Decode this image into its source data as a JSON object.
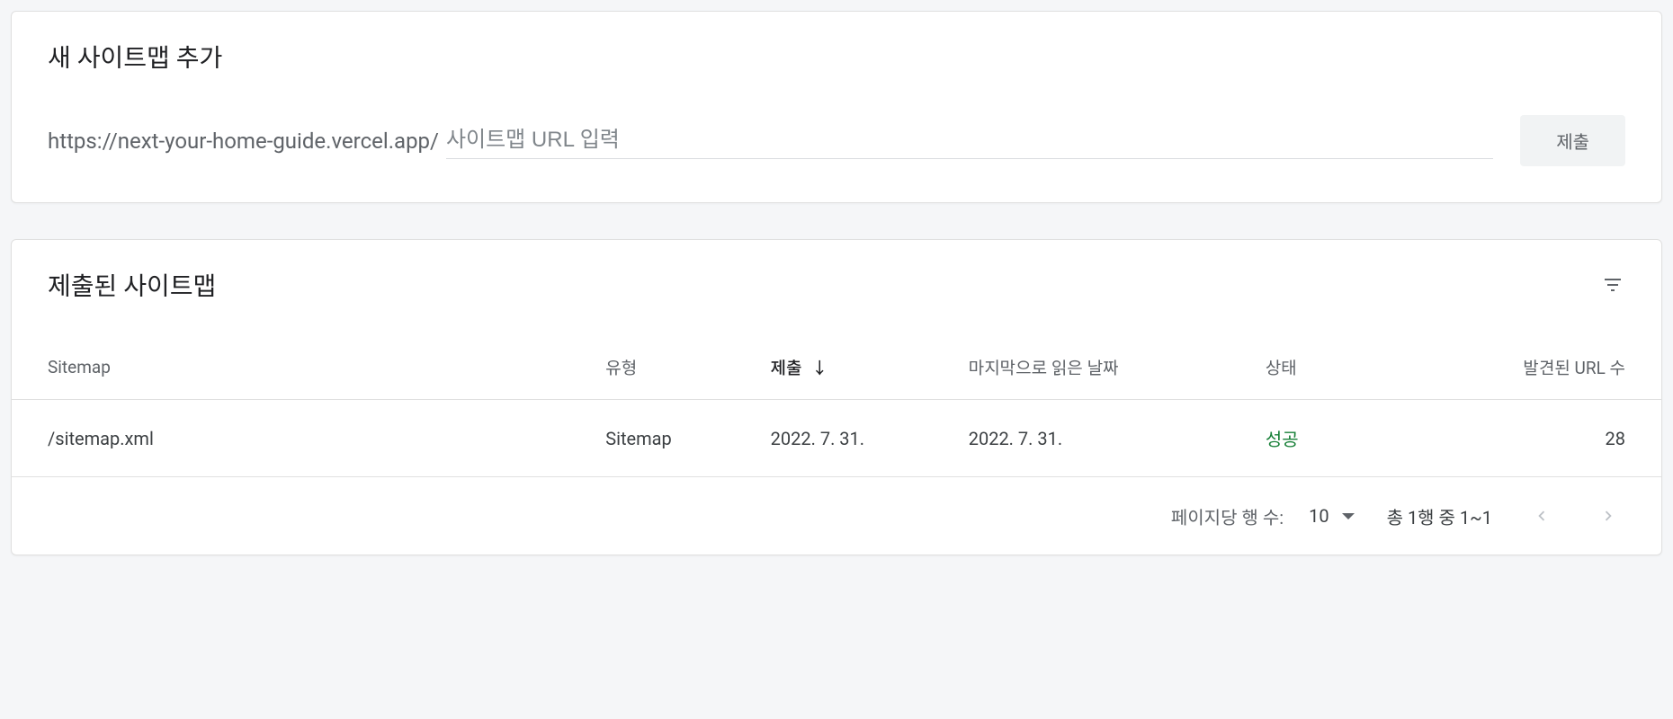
{
  "add_sitemap": {
    "title": "새 사이트맵 추가",
    "url_prefix": "https://next-your-home-guide.vercel.app/",
    "input_placeholder": "사이트맵 URL 입력",
    "submit_label": "제출"
  },
  "submitted_sitemaps": {
    "title": "제출된 사이트맵",
    "columns": {
      "sitemap": "Sitemap",
      "type": "유형",
      "submitted": "제출",
      "last_read": "마지막으로 읽은 날짜",
      "status": "상태",
      "discovered_urls": "발견된 URL 수"
    },
    "rows": [
      {
        "sitemap": "/sitemap.xml",
        "type": "Sitemap",
        "submitted": "2022. 7. 31.",
        "last_read": "2022. 7. 31.",
        "status": "성공",
        "discovered_urls": "28"
      }
    ],
    "pagination": {
      "rows_per_page_label": "페이지당 행 수:",
      "rows_per_page_value": "10",
      "page_info": "총 1행 중 1~1"
    }
  }
}
